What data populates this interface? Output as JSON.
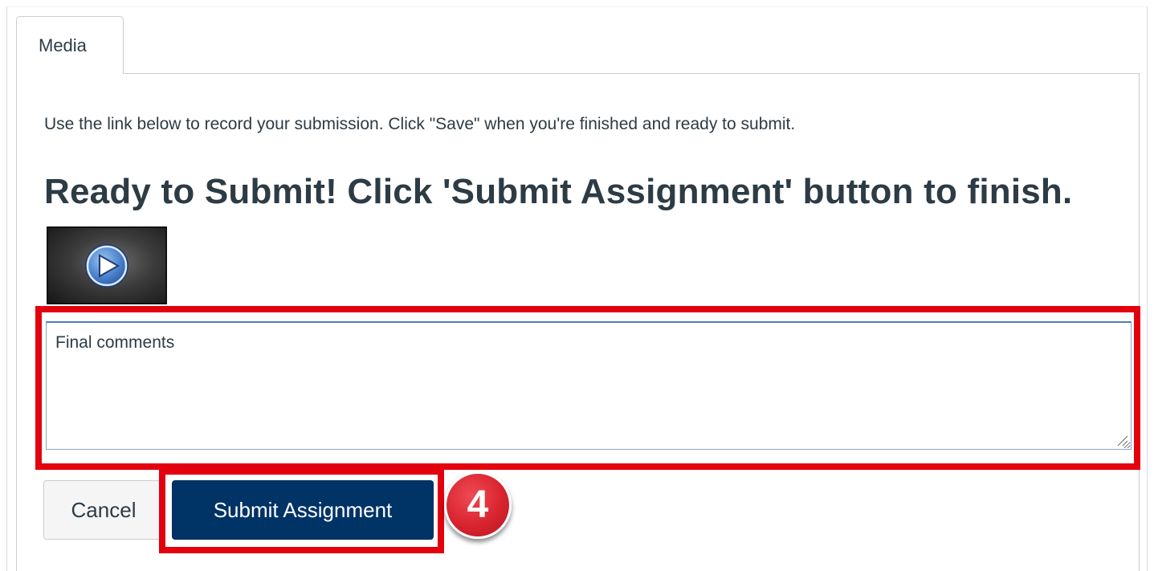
{
  "tabs": [
    {
      "label": "Media",
      "active": true
    }
  ],
  "instructions": "Use the link below to record your submission. Click \"Save\" when you're finished and ready to submit.",
  "heading": "Ready to Submit! Click 'Submit Assignment' button to finish.",
  "media": {
    "icon": "play-icon"
  },
  "comments": {
    "value": "Final comments"
  },
  "buttons": {
    "cancel_label": "Cancel",
    "submit_label": "Submit Assignment"
  },
  "annotation": {
    "step_number": "4",
    "highlight_color": "#e3000f"
  },
  "colors": {
    "primary": "#003366",
    "text": "#2d3b45",
    "border": "#c7cdd1"
  }
}
